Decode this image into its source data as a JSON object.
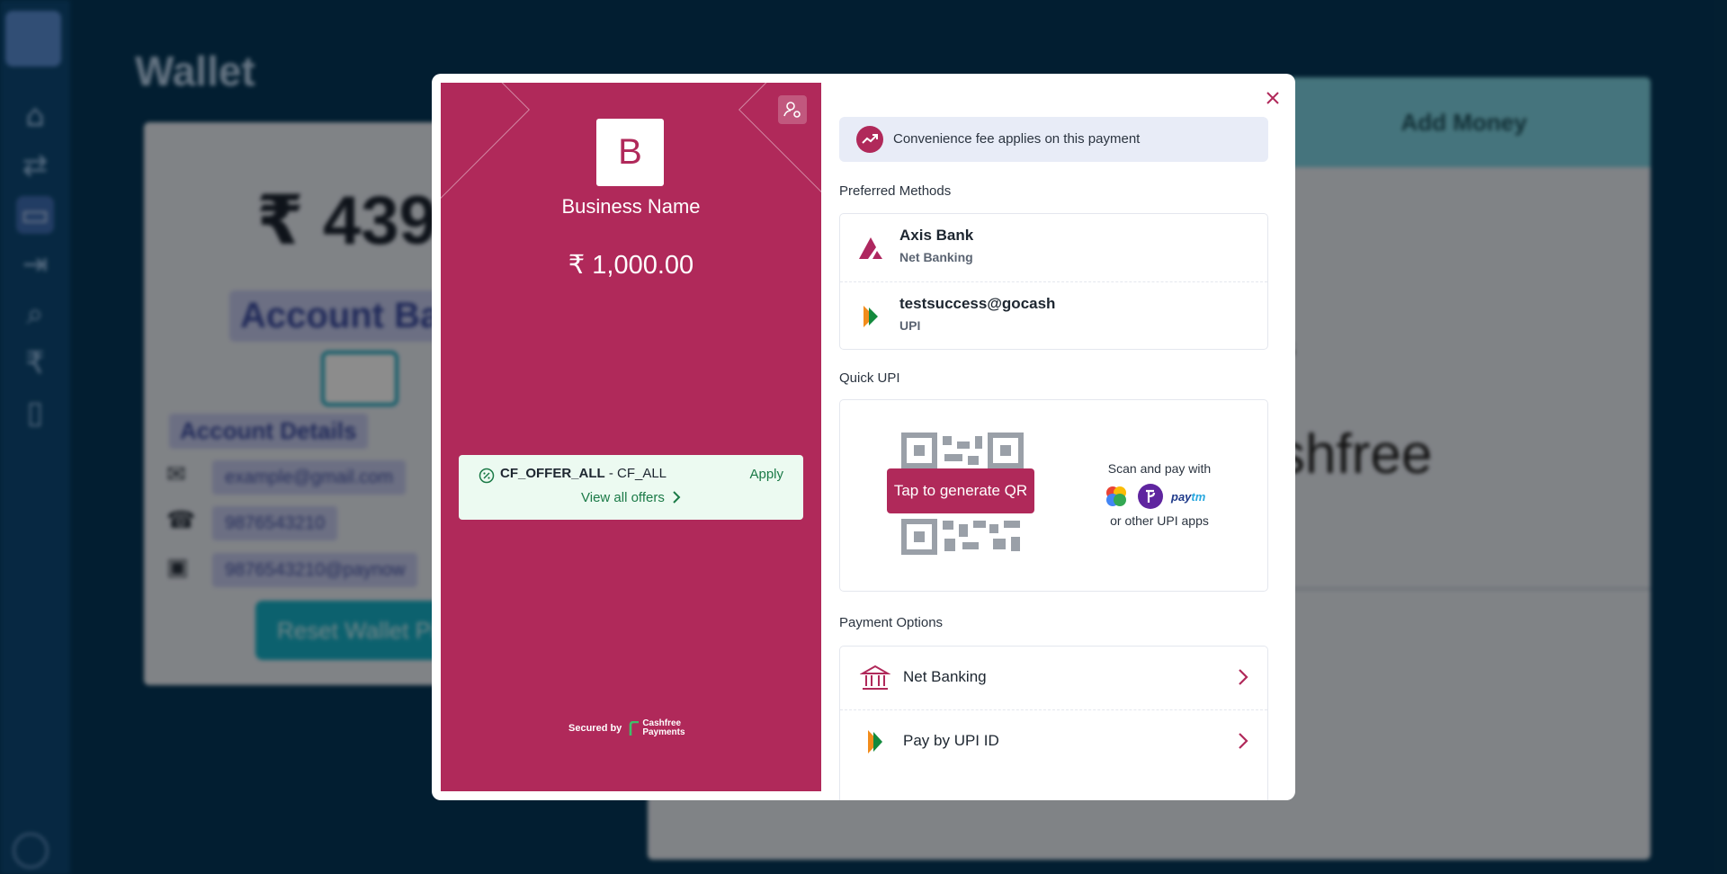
{
  "background": {
    "page_title": "Wallet",
    "balance": "₹ 439",
    "account_balance_label": "Account Bala",
    "account_details_label": "Account Details",
    "email": "example@gmail.com",
    "phone": "9876543210",
    "upi": "9876543210@paynow",
    "reset_button": "Reset Wallet Pi",
    "add_money_tab": "Add Money",
    "brand_fragment": "shfree",
    "small_fragment": "s"
  },
  "checkout": {
    "business": {
      "logo_letter": "B",
      "name": "Business Name",
      "amount": "₹ 1,000.00"
    },
    "offer": {
      "code": "CF_OFFER_ALL",
      "suffix": " - CF_ALL",
      "apply_label": "Apply",
      "view_all_label": "View all offers"
    },
    "secured_by": "Secured by",
    "cashfree_logo_text_1": "Cashfree",
    "cashfree_logo_text_2": "Payments",
    "fee_notice": "Convenience fee applies on this payment",
    "preferred_label": "Preferred Methods",
    "preferred": [
      {
        "title": "Axis Bank",
        "subtitle": "Net Banking"
      },
      {
        "title": "testsuccess@gocash",
        "subtitle": "UPI"
      }
    ],
    "quick_upi_label": "Quick UPI",
    "qr_button": "Tap to generate QR",
    "scan_text": "Scan and pay with",
    "other_text": "or other UPI apps",
    "paytm_pay": "pay",
    "paytm_tm": "tm",
    "payment_options_label": "Payment Options",
    "payment_options": [
      {
        "label": "Net Banking",
        "icon": "bank-icon"
      },
      {
        "label": "Pay by UPI ID",
        "icon": "upi-icon"
      }
    ]
  },
  "colors": {
    "brand": "#b0295a",
    "offer_green": "#1b7a47",
    "backdrop": "#05385a"
  }
}
